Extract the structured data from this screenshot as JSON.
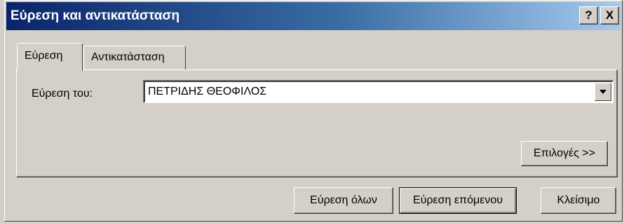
{
  "window": {
    "title": "Εύρεση και αντικατάσταση",
    "help_label": "?",
    "close_label": "X"
  },
  "tabs": [
    {
      "label": "Εύρεση",
      "active": true
    },
    {
      "label": "Αντικατάσταση",
      "active": false
    }
  ],
  "find": {
    "label": "Εύρεση του:",
    "value": "ΠΕΤΡΙΔΗΣ ΘΕΟΦΙΛΟΣ"
  },
  "buttons": {
    "options": "Επιλογές >>",
    "find_all": "Εύρεση όλων",
    "find_next": "Εύρεση επόμενου",
    "close": "Κλείσιμο"
  },
  "colors": {
    "titlebar_start": "#0a246a",
    "titlebar_end": "#a6caf0",
    "face": "#d4d0c8"
  }
}
